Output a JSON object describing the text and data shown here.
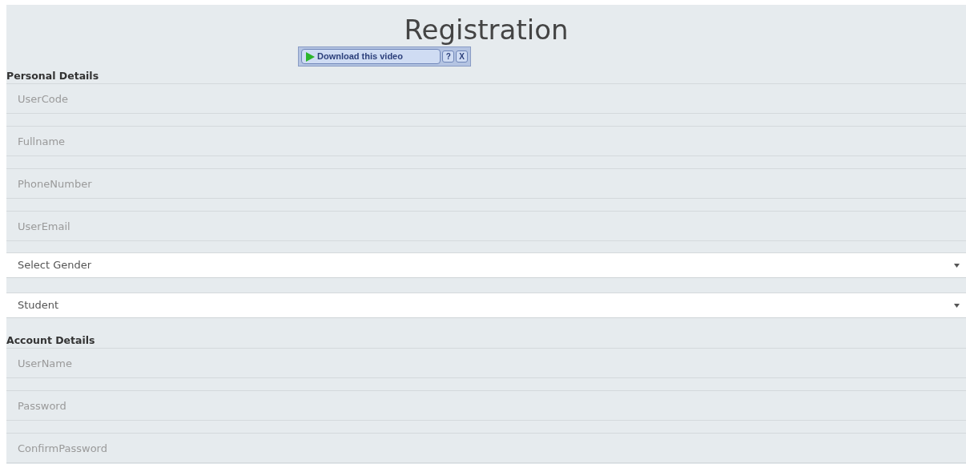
{
  "title": "Registration",
  "overlay": {
    "download_button": "Download this video",
    "help_button": "?",
    "close_button": "X"
  },
  "sections": [
    {
      "heading": "Personal Details",
      "fields": [
        {
          "kind": "text",
          "placeholder": "UserCode"
        },
        {
          "kind": "text",
          "placeholder": "Fullname"
        },
        {
          "kind": "text",
          "placeholder": "PhoneNumber"
        },
        {
          "kind": "text",
          "placeholder": "UserEmail"
        },
        {
          "kind": "select",
          "value": "Select Gender"
        },
        {
          "kind": "select",
          "value": "Student"
        }
      ]
    },
    {
      "heading": "Account Details",
      "fields": [
        {
          "kind": "text",
          "placeholder": "UserName"
        },
        {
          "kind": "text",
          "placeholder": "Password"
        },
        {
          "kind": "text",
          "placeholder": "ConfirmPassword"
        }
      ]
    }
  ]
}
